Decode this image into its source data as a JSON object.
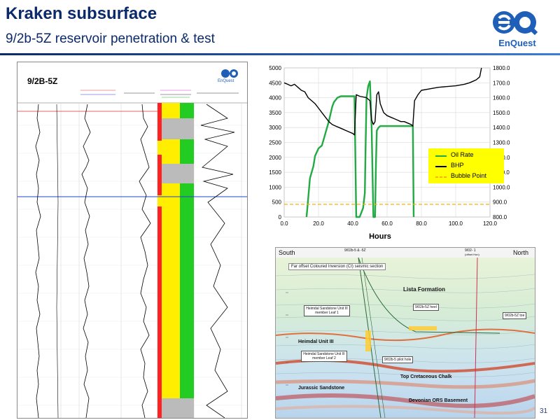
{
  "header": {
    "title": "Kraken subsurface",
    "subtitle": "9/2b-5Z reservoir penetration & test",
    "brand": "EnQuest",
    "page_number": "31"
  },
  "log_panel": {
    "well_name": "9/2B-5Z",
    "brand": "EnQuest"
  },
  "chart": {
    "xlabel": "Hours",
    "legend": [
      "Oil Rate",
      "BHP",
      "Bubble Point"
    ],
    "colors": {
      "oil_rate": "#22aa44",
      "bhp": "#000000",
      "bubble_point": "#f4b400"
    }
  },
  "chart_data": {
    "type": "line",
    "xlabel": "Hours",
    "xlim": [
      0,
      120
    ],
    "xticks": [
      "0.0",
      "20.0",
      "40.0",
      "60.0",
      "80.0",
      "100.0",
      "120.0"
    ],
    "y_left": {
      "lim": [
        0,
        5000
      ],
      "ticks": [
        "0",
        "500",
        "1000",
        "1500",
        "2000",
        "2500",
        "3000",
        "3500",
        "4000",
        "4500",
        "5000"
      ]
    },
    "y_right": {
      "lim": [
        800,
        1800
      ],
      "ticks": [
        "800.0",
        "900.0",
        "1000.0",
        "1100.0",
        "1200.0",
        "1300.0",
        "1400.0",
        "1500.0",
        "1600.0",
        "1700.0",
        "1800.0"
      ]
    },
    "grid": true,
    "legend_position": "right",
    "series": [
      {
        "name": "Oil Rate",
        "axis": "left",
        "x": [
          13,
          13.5,
          15,
          17,
          18,
          20,
          22,
          24,
          26,
          28,
          29,
          31,
          33,
          36,
          38,
          40,
          41,
          41.5,
          42,
          44,
          46,
          47,
          47.5,
          48,
          49,
          50,
          51,
          52,
          53,
          53.5,
          54,
          55,
          56,
          58,
          60,
          62,
          64,
          66,
          68,
          70,
          72,
          73,
          74,
          75,
          75.5
        ],
        "y": [
          0,
          300,
          1300,
          1700,
          2050,
          2300,
          2400,
          2800,
          3200,
          3700,
          3850,
          4000,
          4050,
          4050,
          4050,
          4050,
          4050,
          2000,
          0,
          0,
          300,
          800,
          2500,
          4000,
          4400,
          4550,
          3000,
          0,
          0,
          1800,
          2900,
          3000,
          3050,
          3050,
          3050,
          3050,
          3050,
          3050,
          3050,
          3050,
          3050,
          3050,
          3050,
          3050,
          0
        ]
      },
      {
        "name": "BHP",
        "axis": "right",
        "x": [
          0,
          2,
          4,
          6,
          8,
          10,
          12,
          14,
          16,
          18,
          20,
          22,
          24,
          26,
          28,
          30,
          32,
          34,
          36,
          38,
          40,
          41,
          42,
          44,
          46,
          48,
          50,
          51,
          52,
          53,
          54,
          55,
          56,
          58,
          60,
          62,
          64,
          66,
          68,
          70,
          72,
          74,
          75,
          76,
          78,
          80,
          90,
          100,
          105,
          108,
          110,
          112,
          114,
          115
        ],
        "y": [
          1700,
          1690,
          1680,
          1690,
          1670,
          1650,
          1640,
          1600,
          1580,
          1560,
          1530,
          1500,
          1470,
          1440,
          1420,
          1410,
          1400,
          1390,
          1380,
          1370,
          1360,
          1350,
          1620,
          1610,
          1605,
          1600,
          1580,
          1450,
          1420,
          1440,
          1620,
          1640,
          1560,
          1500,
          1480,
          1470,
          1460,
          1450,
          1440,
          1440,
          1430,
          1420,
          1410,
          1580,
          1620,
          1650,
          1670,
          1680,
          1690,
          1700,
          1710,
          1720,
          1740,
          1800
        ]
      },
      {
        "name": "Bubble Point",
        "axis": "right",
        "x": [
          0,
          120
        ],
        "y": [
          885,
          885
        ]
      }
    ]
  },
  "seismic": {
    "south_label": "South",
    "north_label": "North",
    "well_label_left": "9/02b-5 & -5Z",
    "well_label_right": "9/02- 1",
    "well_label_right_sub": "(offset Hon)",
    "caption": "Far offset Coloured Inversion (CI) seismic section",
    "lista_formation": "Lista Formation",
    "heimdal_unit": "Heimdal Unit III",
    "top_chalk": "Top Cretaceous Chalk",
    "jurassic": "Jurassic Sandstone",
    "devonian": "Devonian ORS Basement",
    "heel": "9/02b-5Z heel",
    "toe": "9/02b-5Z toe",
    "pilot_hole": "9/02b-5 pilot hole",
    "leaf1": "Heimdal Sandstone Unit III member Leaf 1",
    "leaf2": "Heimdal Sandstone Unit III member Leaf 2"
  }
}
